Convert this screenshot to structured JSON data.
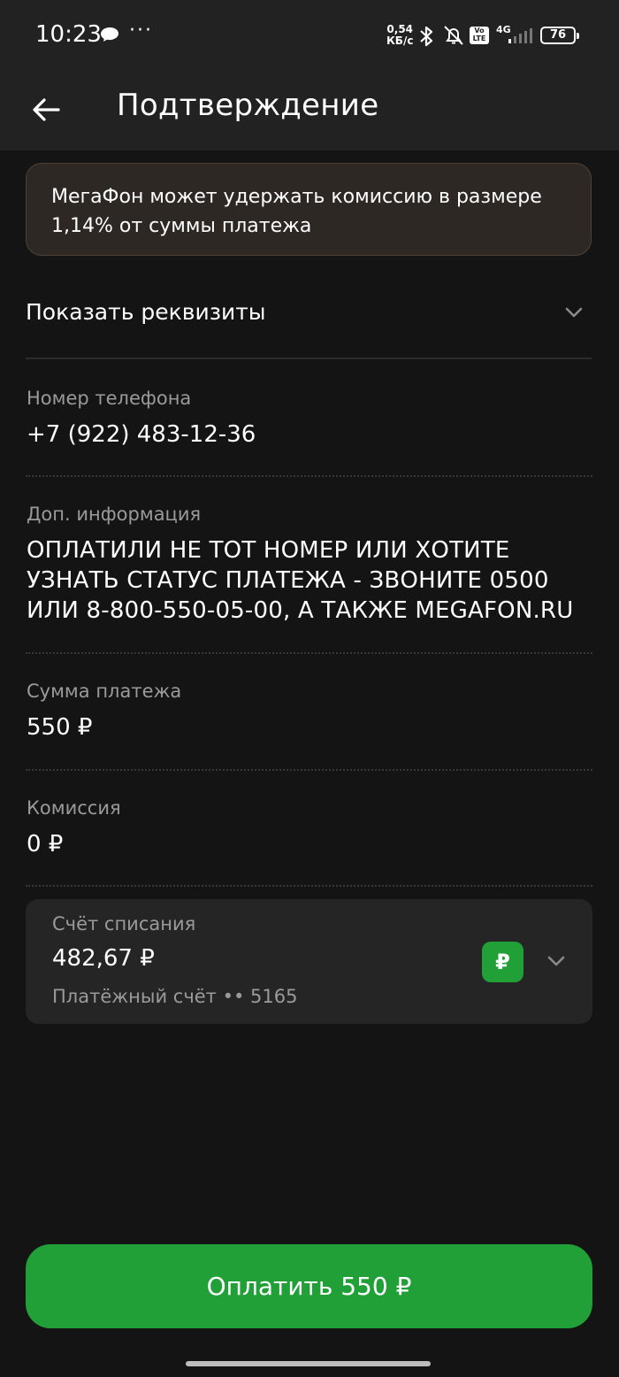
{
  "status_bar": {
    "time": "10:23",
    "more": "···",
    "net_speed_value": "0,54",
    "net_speed_unit": "КБ/с",
    "volte_line1": "Vo",
    "volte_line2": "LTE",
    "network": "4G",
    "battery": "76"
  },
  "header": {
    "title": "Подтверждение",
    "back_icon": "arrow-left-icon"
  },
  "notice": {
    "text": "МегаФон может удержать комиссию в размере 1,14% от суммы платежа"
  },
  "details_toggle": {
    "label": "Показать реквизиты",
    "icon": "chevron-down-icon"
  },
  "fields": {
    "phone": {
      "label": "Номер телефона",
      "value": "+7 (922) 483-12-36"
    },
    "extra_info": {
      "label": "Доп. информация",
      "value": "ОПЛАТИЛИ НЕ ТОТ НОМЕР ИЛИ ХОТИТЕ УЗНАТЬ СТАТУС ПЛАТЕЖА - ЗВОНИТЕ 0500 ИЛИ 8-800-550-05-00, А ТАКЖЕ MEGAFON.RU"
    },
    "amount": {
      "label": "Сумма платежа",
      "value": "550 ₽"
    },
    "commission": {
      "label": "Комиссия",
      "value": "0 ₽"
    }
  },
  "account": {
    "label": "Счёт списания",
    "balance": "482,67 ₽",
    "name": "Платёжный счёт •• 5165",
    "currency_symbol": "₽",
    "icon": "chevron-down-icon"
  },
  "pay_button": {
    "label": "Оплатить 550 ₽"
  },
  "colors": {
    "background": "#141414",
    "header": "#222222",
    "accent_green": "#21a038",
    "notice_bg": "#2e2824",
    "card_bg": "#252525",
    "secondary_text": "#9a9a9a"
  }
}
